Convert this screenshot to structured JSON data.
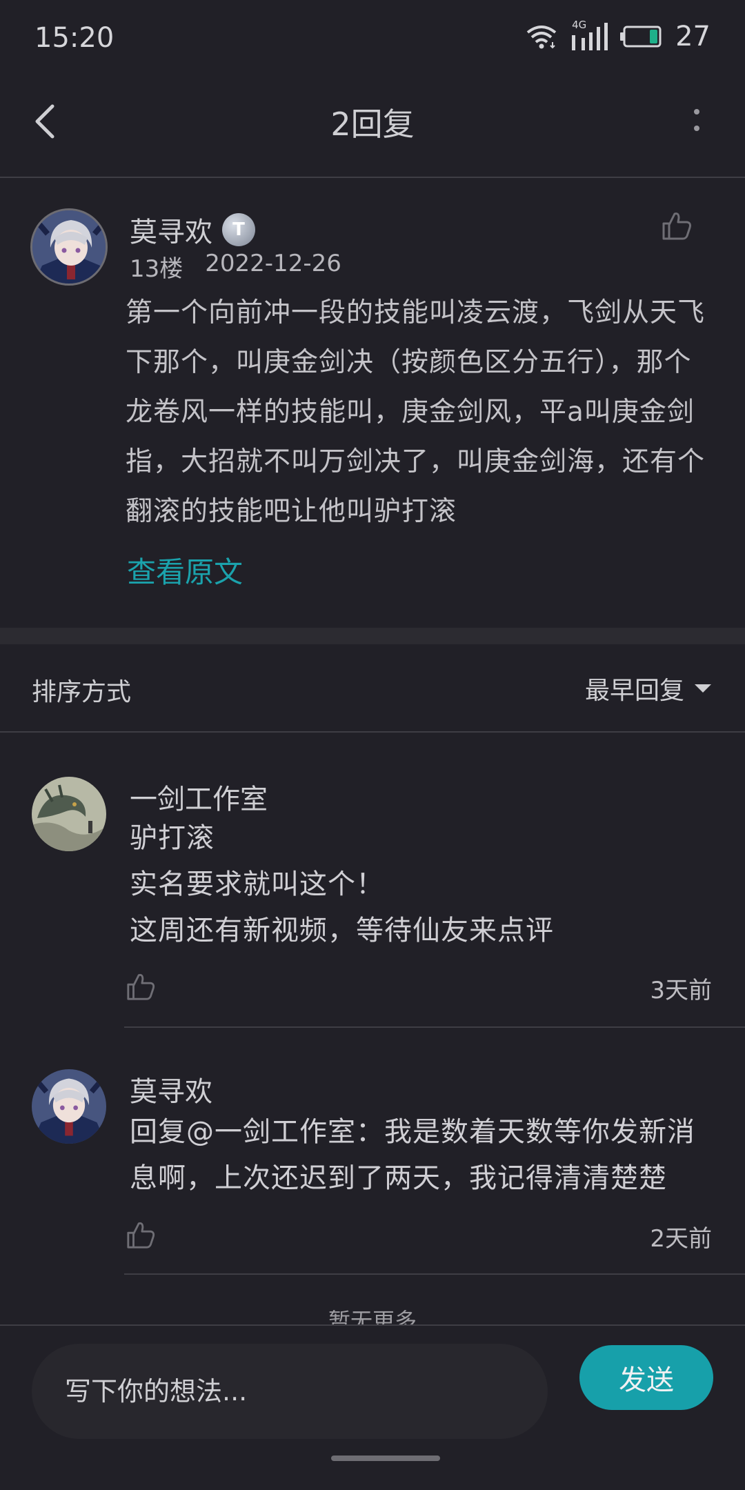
{
  "status_bar": {
    "time": "15:20",
    "network": "4G",
    "battery": "27"
  },
  "header": {
    "title": "2回复"
  },
  "post": {
    "author": "莫寻欢",
    "badge": "T",
    "floor": "13楼",
    "date": "2022-12-26",
    "content": "第一个向前冲一段的技能叫凌云渡，飞剑从天飞下那个，叫庚金剑决（按颜色区分五行），那个龙卷风一样的技能叫，庚金剑风，平a叫庚金剑指，大招就不叫万剑决了，叫庚金剑海，还有个翻滚的技能吧让他叫驴打滚",
    "view_original": "查看原文"
  },
  "sort": {
    "label": "排序方式",
    "selected": "最早回复"
  },
  "replies": [
    {
      "author": "一剑工作室",
      "lines": [
        "驴打滚",
        "实名要求就叫这个！",
        "这周还有新视频，等待仙友来点评"
      ],
      "time": "3天前"
    },
    {
      "author": "莫寻欢",
      "lines": [
        "回复@一剑工作室：我是数着天数等你发新消",
        "息啊，上次还迟到了两天，我记得清清楚楚"
      ],
      "time": "2天前"
    }
  ],
  "footer_note": "暂无更多",
  "composer": {
    "placeholder": "写下你的想法...",
    "send_label": "发送"
  },
  "colors": {
    "background": "#212027",
    "accent": "#17a0aa"
  }
}
